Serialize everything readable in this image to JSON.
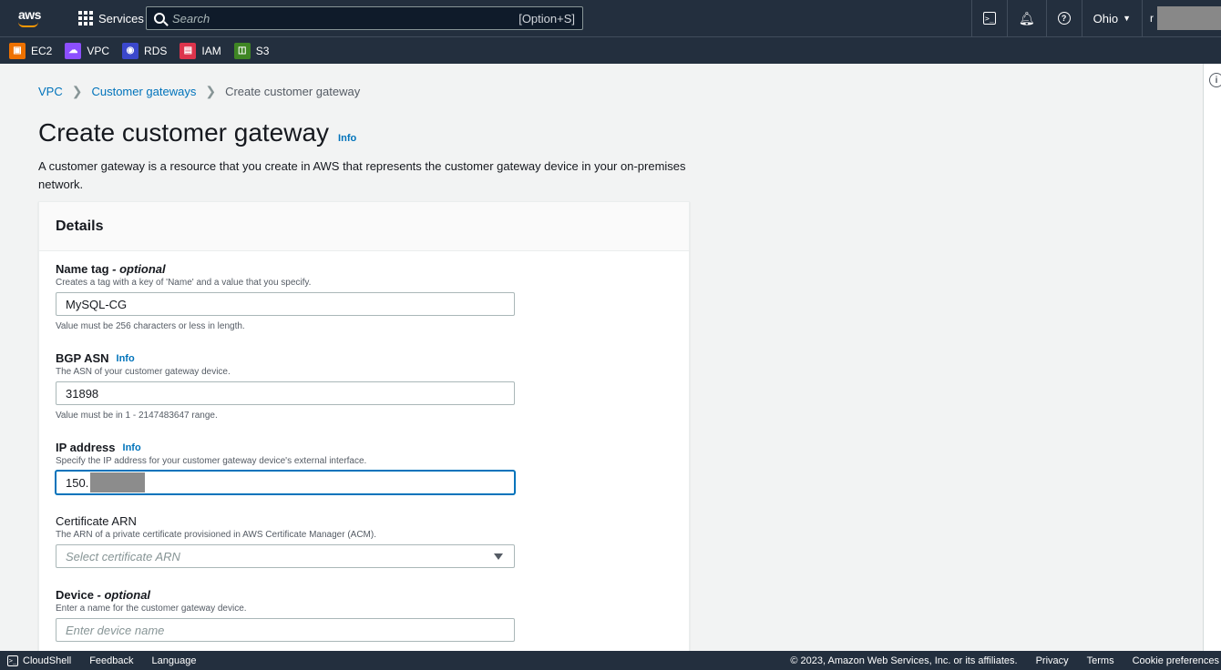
{
  "topnav": {
    "logo_text": "aws",
    "services_label": "Services",
    "search_placeholder": "Search",
    "search_shortcut": "[Option+S]",
    "region_label": "Ohio",
    "user_initial": "r"
  },
  "favorites": [
    {
      "label": "EC2",
      "color": "#ed7100",
      "icon": "ec2-icon"
    },
    {
      "label": "VPC",
      "color": "#8c4fff",
      "icon": "vpc-icon"
    },
    {
      "label": "RDS",
      "color": "#3b48cc",
      "icon": "rds-icon"
    },
    {
      "label": "IAM",
      "color": "#dd344c",
      "icon": "iam-icon"
    },
    {
      "label": "S3",
      "color": "#3f8624",
      "icon": "s3-icon"
    }
  ],
  "breadcrumb": {
    "items": [
      "VPC",
      "Customer gateways"
    ],
    "current": "Create customer gateway"
  },
  "page": {
    "title": "Create customer gateway",
    "info": "Info",
    "description": "A customer gateway is a resource that you create in AWS that represents the customer gateway device in your on-premises network."
  },
  "details": {
    "header": "Details",
    "name_tag": {
      "label": "Name tag",
      "optional": "- optional",
      "desc": "Creates a tag with a key of 'Name' and a value that you specify.",
      "value": "MySQL-CG",
      "constraint": "Value must be 256 characters or less in length."
    },
    "bgp_asn": {
      "label": "BGP ASN",
      "info": "Info",
      "desc": "The ASN of your customer gateway device.",
      "value": "31898",
      "constraint": "Value must be in 1 - 2147483647 range."
    },
    "ip_address": {
      "label": "IP address",
      "info": "Info",
      "desc": "Specify the IP address for your customer gateway device's external interface.",
      "value": "150."
    },
    "certificate_arn": {
      "label": "Certificate ARN",
      "desc": "The ARN of a private certificate provisioned in AWS Certificate Manager (ACM).",
      "placeholder": "Select certificate ARN"
    },
    "device": {
      "label": "Device",
      "optional": "- optional",
      "desc": "Enter a name for the customer gateway device.",
      "placeholder": "Enter device name"
    }
  },
  "footer": {
    "cloudshell": "CloudShell",
    "feedback": "Feedback",
    "language": "Language",
    "copyright": "© 2023, Amazon Web Services, Inc. or its affiliates.",
    "privacy": "Privacy",
    "terms": "Terms",
    "cookie": "Cookie preferences"
  },
  "colors": {
    "nav_bg": "#232f3e",
    "link": "#0073bb",
    "focus": "#0073bb"
  }
}
